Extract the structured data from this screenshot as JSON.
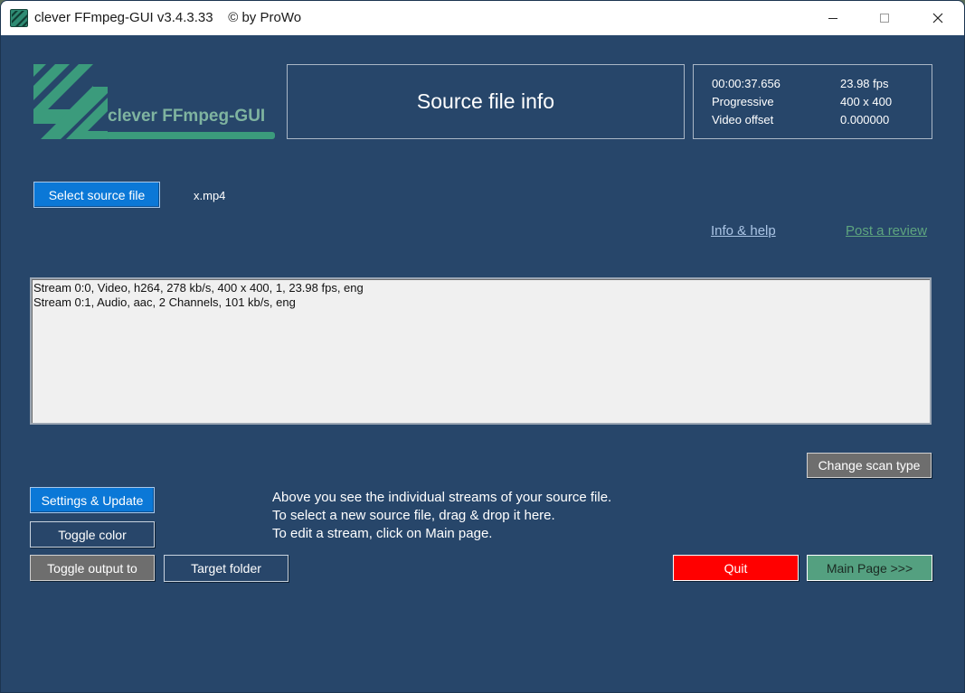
{
  "window": {
    "title": "clever FFmpeg-GUI v3.4.3.33    © by ProWo",
    "controls": {
      "minimize_icon": "minimize-icon",
      "maximize_icon": "maximize-icon",
      "close_icon": "close-icon"
    }
  },
  "logo": {
    "text": "clever FFmpeg-GUI",
    "color": "#3b9b7c"
  },
  "header": {
    "title": "Source file info"
  },
  "file_info": {
    "duration": "00:00:37.656",
    "fps": "23.98 fps",
    "scan_type": "Progressive",
    "resolution": "400 x 400",
    "offset_label": "Video offset",
    "offset_value": "0.000000"
  },
  "source": {
    "select_label": "Select source file",
    "filename": "x.mp4"
  },
  "links": {
    "info_help": "Info & help",
    "post_review": "Post a review"
  },
  "streams": [
    "Stream 0:0, Video, h264, 278 kb/s, 400 x 400, 1, 23.98 fps, eng",
    "Stream 0:1, Audio, aac, 2 Channels, 101 kb/s, eng"
  ],
  "buttons": {
    "change_scan_type": "Change scan type",
    "settings_update": "Settings & Update",
    "toggle_color": "Toggle color",
    "toggle_output": "Toggle output to",
    "target_folder": "Target folder",
    "quit": "Quit",
    "main_page": "Main Page >>>"
  },
  "hint": {
    "line1": "Above you see the individual streams of your source file.",
    "line2": "To select a new source file, drag & drop it here.",
    "line3": "To edit a stream, click on Main page."
  },
  "colors": {
    "background": "#27466a",
    "accent_blue": "#0b78d7",
    "quit_red": "#ff0000",
    "main_page_green": "#54a080",
    "gray_button": "#6e6e6e"
  }
}
